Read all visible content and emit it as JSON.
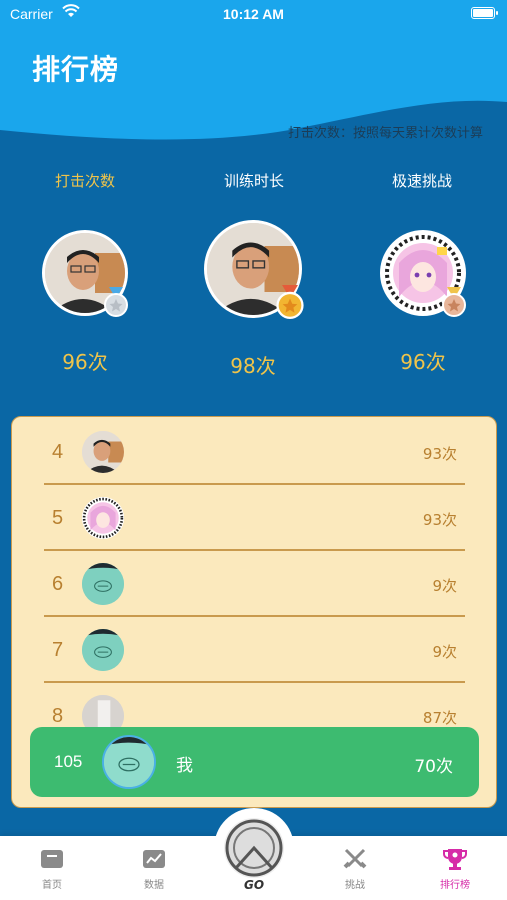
{
  "status_bar": {
    "carrier": "Carrier",
    "time": "10:12 AM"
  },
  "page": {
    "title": "排行榜",
    "note": "打击次数：按照每天累计次数计算"
  },
  "tabs": [
    {
      "label": "打击次数",
      "active": true
    },
    {
      "label": "训练时长",
      "active": false
    },
    {
      "label": "极速挑战",
      "active": false
    }
  ],
  "podium": {
    "first": {
      "count": "98次",
      "medal": "gold"
    },
    "second": {
      "count": "96次",
      "medal": "silver"
    },
    "third": {
      "count": "96次",
      "medal": "bronze"
    }
  },
  "rankings": [
    {
      "rank": "4",
      "count": "93次",
      "avatar": "man-photo"
    },
    {
      "rank": "5",
      "count": "93次",
      "avatar": "anime-girl"
    },
    {
      "rank": "6",
      "count": "9次",
      "avatar": "brand-logo"
    },
    {
      "rank": "7",
      "count": "9次",
      "avatar": "brand-logo"
    },
    {
      "rank": "8",
      "count": "87次",
      "avatar": "grey-photo"
    }
  ],
  "me": {
    "rank": "105",
    "name": "我",
    "count": "70次"
  },
  "tabbar": {
    "home": "首页",
    "data": "数据",
    "go": "GO",
    "challenge": "挑战",
    "ranking": "排行榜"
  },
  "colors": {
    "header_sky": "#1aa6ec",
    "background": "#0a67a5",
    "accent_gold": "#f0c44a",
    "card": "#fbe9bd",
    "me_row": "#3dbb70",
    "tab_active": "#d62ba8"
  }
}
